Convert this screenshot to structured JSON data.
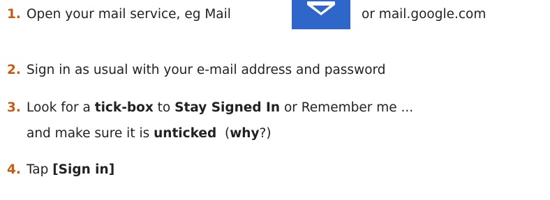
{
  "steps": [
    {
      "number": "1.",
      "text_before_icon": "Open your mail service, eg Mail",
      "icon": "mail-envelope-icon",
      "text_after_icon": "or mail.google.com"
    },
    {
      "number": "2.",
      "text": "Sign in as usual with your e-mail address and password"
    },
    {
      "number": "3.",
      "line1": {
        "t1": "Look for a ",
        "b1": "tick-box",
        "t2": " to ",
        "b2": "Stay Signed In",
        "t3": " or Remember me ..."
      },
      "line2": {
        "t1": "and make sure it is ",
        "b1": "unticked",
        "t2": "  (",
        "b2": "why",
        "t3": "?)"
      }
    },
    {
      "number": "4.",
      "text": "Tap ",
      "bold": "[Sign in]"
    }
  ],
  "colors": {
    "number": "#c75b12",
    "icon_bg": "#2f66c9",
    "text": "#222222"
  }
}
